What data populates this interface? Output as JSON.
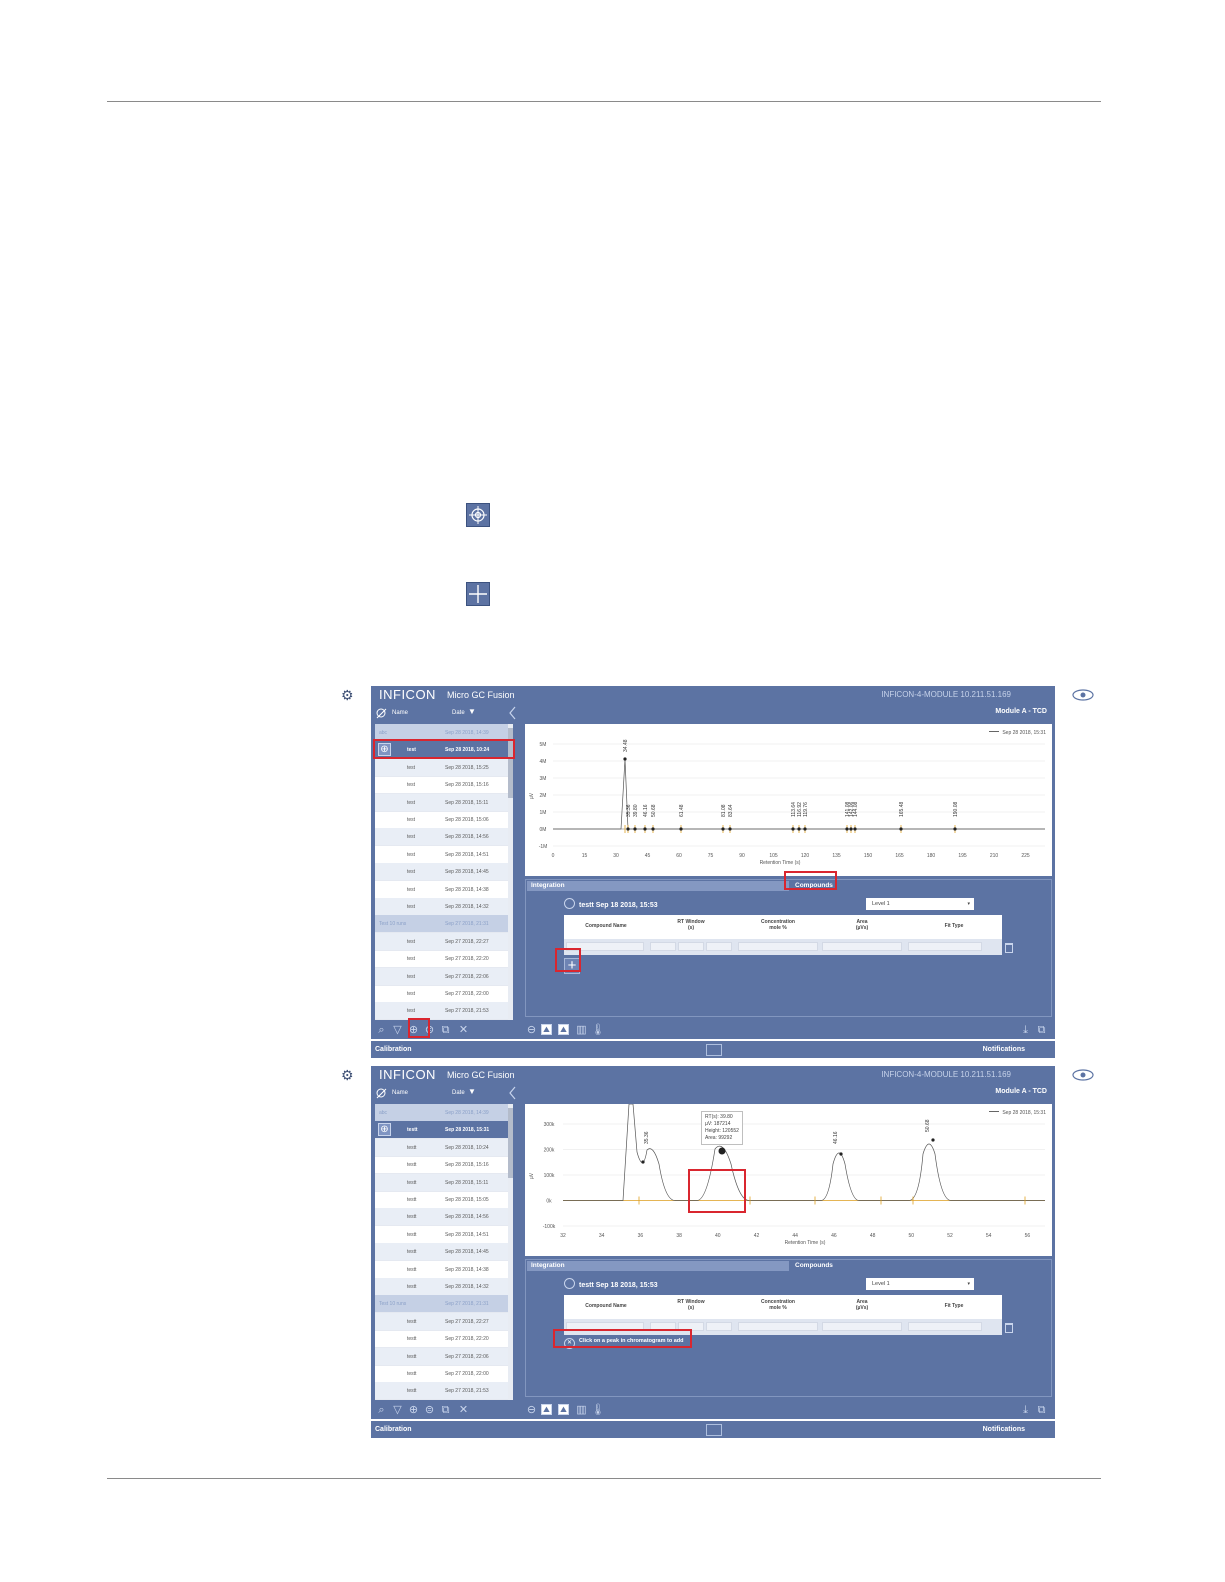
{
  "app": {
    "logo": "INFICON",
    "product": "Micro GC Fusion",
    "device": "INFICON-4-MODULE 10.211.51.169",
    "module": "Module A - TCD",
    "list_header_name": "Name",
    "list_header_date": "Date",
    "tab_integration": "Integration",
    "tab_compounds": "Compounds",
    "run_title": "testt Sep 18 2018, 15:53",
    "level": "Level 1",
    "col_compound": "Compound Name",
    "col_rt_window": "RT Window",
    "col_rt_unit": "(s)",
    "col_conc": "Concentration",
    "col_conc_unit": "mole %",
    "col_area": "Area",
    "col_area_unit": "(µVs)",
    "col_fit": "Fit Type",
    "footer_left": "Calibration",
    "footer_right": "Notifications",
    "legend_run": "Sep 28 2018, 15:31",
    "hint": "Click on a peak in chromatogram to add"
  },
  "screen1": {
    "rows": [
      {
        "name": "abc",
        "date": "Sep 28 2018, 14:39",
        "kind": "group"
      },
      {
        "name": "test",
        "date": "Sep 28 2018, 10:24",
        "kind": "sel"
      },
      {
        "name": "test",
        "date": "Sep 28 2018, 15:25",
        "kind": "alt"
      },
      {
        "name": "test",
        "date": "Sep 28 2018, 15:16",
        "kind": ""
      },
      {
        "name": "test",
        "date": "Sep 28 2018, 15:11",
        "kind": "alt"
      },
      {
        "name": "test",
        "date": "Sep 28 2018, 15:06",
        "kind": ""
      },
      {
        "name": "test",
        "date": "Sep 28 2018, 14:56",
        "kind": "alt"
      },
      {
        "name": "test",
        "date": "Sep 28 2018, 14:51",
        "kind": ""
      },
      {
        "name": "test",
        "date": "Sep 28 2018, 14:45",
        "kind": "alt"
      },
      {
        "name": "test",
        "date": "Sep 28 2018, 14:38",
        "kind": ""
      },
      {
        "name": "test",
        "date": "Sep 28 2018, 14:32",
        "kind": "alt"
      },
      {
        "name": "Test 10 runs",
        "date": "Sep 27 2018, 21:31",
        "kind": "group"
      },
      {
        "name": "test",
        "date": "Sep 27 2018, 22:27",
        "kind": "alt"
      },
      {
        "name": "test",
        "date": "Sep 27 2018, 22:20",
        "kind": ""
      },
      {
        "name": "test",
        "date": "Sep 27 2018, 22:06",
        "kind": "alt"
      },
      {
        "name": "test",
        "date": "Sep 27 2018, 22:00",
        "kind": ""
      },
      {
        "name": "test",
        "date": "Sep 27 2018, 21:53",
        "kind": "alt"
      }
    ],
    "chart": {
      "xlabel": "Retention Time (s)",
      "ylabel": "µV",
      "xticks": [
        "0",
        "15",
        "30",
        "45",
        "60",
        "75",
        "90",
        "105",
        "120",
        "135",
        "150",
        "165",
        "180",
        "195",
        "210",
        "225"
      ],
      "yticks": [
        "5M",
        "4M",
        "3M",
        "2M",
        "1M",
        "0M",
        "-1M"
      ],
      "peak_labels": [
        "34.48",
        "35.36",
        "39.80",
        "46.16",
        "50.68",
        "61.48",
        "81.08",
        "83.64",
        "113.64",
        "116.92",
        "119.76",
        "141.08",
        "142.06",
        "144.08",
        "165.48",
        "190.08"
      ]
    }
  },
  "screen2": {
    "rows": [
      {
        "name": "abc",
        "date": "Sep 28 2018, 14:39",
        "kind": "group"
      },
      {
        "name": "testt",
        "date": "Sep 28 2018, 15:31",
        "kind": "sel"
      },
      {
        "name": "testt",
        "date": "Sep 28 2018, 10:24",
        "kind": "alt"
      },
      {
        "name": "testt",
        "date": "Sep 28 2018, 15:16",
        "kind": ""
      },
      {
        "name": "testt",
        "date": "Sep 28 2018, 15:11",
        "kind": "alt"
      },
      {
        "name": "testt",
        "date": "Sep 28 2018, 15:05",
        "kind": ""
      },
      {
        "name": "testt",
        "date": "Sep 28 2018, 14:56",
        "kind": "alt"
      },
      {
        "name": "testt",
        "date": "Sep 28 2018, 14:51",
        "kind": ""
      },
      {
        "name": "testt",
        "date": "Sep 28 2018, 14:45",
        "kind": "alt"
      },
      {
        "name": "testt",
        "date": "Sep 28 2018, 14:38",
        "kind": ""
      },
      {
        "name": "testt",
        "date": "Sep 28 2018, 14:32",
        "kind": "alt"
      },
      {
        "name": "Test 10 runs",
        "date": "Sep 27 2018, 21:31",
        "kind": "group"
      },
      {
        "name": "testt",
        "date": "Sep 27 2018, 22:27",
        "kind": "alt"
      },
      {
        "name": "testt",
        "date": "Sep 27 2018, 22:20",
        "kind": ""
      },
      {
        "name": "testt",
        "date": "Sep 27 2018, 22:06",
        "kind": "alt"
      },
      {
        "name": "testt",
        "date": "Sep 27 2018, 22:00",
        "kind": ""
      },
      {
        "name": "testt",
        "date": "Sep 27 2018, 21:53",
        "kind": "alt"
      }
    ],
    "chart": {
      "xlabel": "Retention Time (s)",
      "ylabel": "µV",
      "yticks": [
        "300k",
        "200k",
        "100k",
        "0k",
        "-100k"
      ],
      "xticks": [
        "32",
        "34",
        "36",
        "38",
        "40",
        "42",
        "44",
        "46",
        "48",
        "50",
        "52",
        "54",
        "56"
      ],
      "peak_labels": [
        "35.36",
        "46.16",
        "50.68"
      ],
      "tooltip": [
        "RT(s): 39.80",
        "µV: 187214",
        "Height: 120552",
        "Area: 99292"
      ]
    }
  },
  "colors": {
    "frame": "#5c73a3",
    "highlight": "#d9262f",
    "baseline": "#e0a020"
  },
  "icons": [
    "target-icon",
    "add-icon",
    "search-icon",
    "filter-icon",
    "trash-icon",
    "eye-icon",
    "gear-icon",
    "wrench-icon"
  ]
}
